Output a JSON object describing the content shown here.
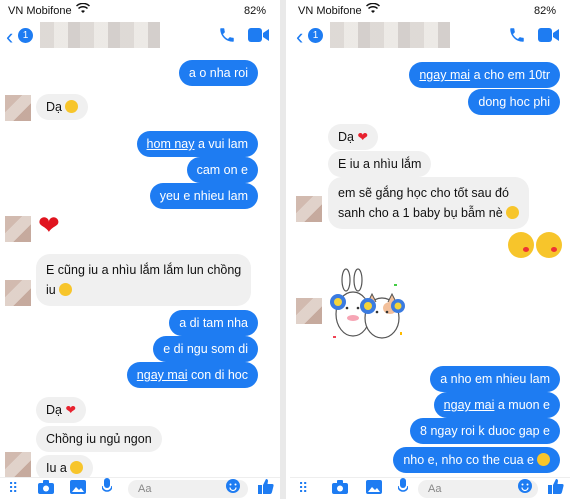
{
  "left": {
    "status": {
      "carrier": "VN Mobifone",
      "battery": "82%"
    },
    "nav": {
      "badge": "1"
    },
    "messages": {
      "m1": "a o nha roi",
      "m2_text": "Dạ",
      "m3_link": "hom nay",
      "m3_rest": " a vui lam",
      "m4": "cam on e",
      "m5": "yeu e nhieu lam",
      "m6_line1": "E cũng iu a nhìu lắm lắm lun chồng",
      "m6_line2": "iu",
      "m7": "a di tam nha",
      "m8": "e di ngu som di",
      "m9_link": "ngay mai",
      "m9_rest": " con di hoc",
      "m10_text": "Dạ",
      "m11": "Chồng iu ngủ ngon",
      "m12_text": "Iu a"
    },
    "input_placeholder": "Aa"
  },
  "right": {
    "status": {
      "carrier": "VN Mobifone",
      "battery": "82%"
    },
    "nav": {
      "badge": "1"
    },
    "messages": {
      "r1_link": "ngay mai",
      "r1_rest": " a cho em 10tr",
      "r2": "dong hoc phi",
      "r3_text": "Dạ",
      "r4": "E iu a nhìu lắm",
      "r5_line1": "em sẽ gắng học cho tốt sau đó",
      "r5_line2": "sanh cho a 1 baby bụ bẫm nè",
      "r6": "a nho em nhieu lam",
      "r7_link": "ngay mai",
      "r7_rest": " a muon e",
      "r8": "8 ngay roi k duoc gap e",
      "r9": "nho e, nho co the cua e"
    },
    "input_placeholder": "Aa"
  },
  "colors": {
    "accent": "#1e7cf2",
    "incoming_bubble": "#f0f0f0"
  }
}
